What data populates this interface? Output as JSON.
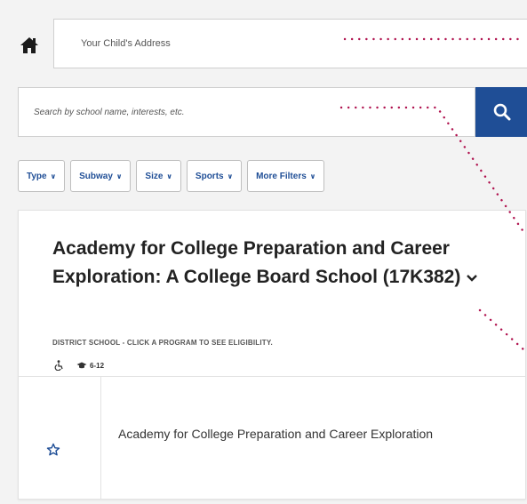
{
  "search": {
    "address_placeholder": "Your Child's Address",
    "query_placeholder": "Search by school name, interests, etc."
  },
  "filters": [
    {
      "label": "Type"
    },
    {
      "label": "Subway"
    },
    {
      "label": "Size"
    },
    {
      "label": "Sports"
    },
    {
      "label": "More Filters"
    }
  ],
  "school": {
    "name": "Academy for College Preparation and Career Exploration: A College Board School (17K382)",
    "subtitle": "DISTRICT SCHOOL - CLICK A PROGRAM TO SEE ELIGIBILITY.",
    "grades": "6-12",
    "program": "Academy for College Preparation and Career Exploration"
  },
  "icons": {
    "home": "home-icon",
    "search": "search-icon",
    "accessibility": "wheelchair-icon",
    "grades": "graduation-cap-icon",
    "favorite": "star-outline-icon"
  },
  "colors": {
    "accent": "#1f4e96",
    "annotation": "#b0134f"
  }
}
